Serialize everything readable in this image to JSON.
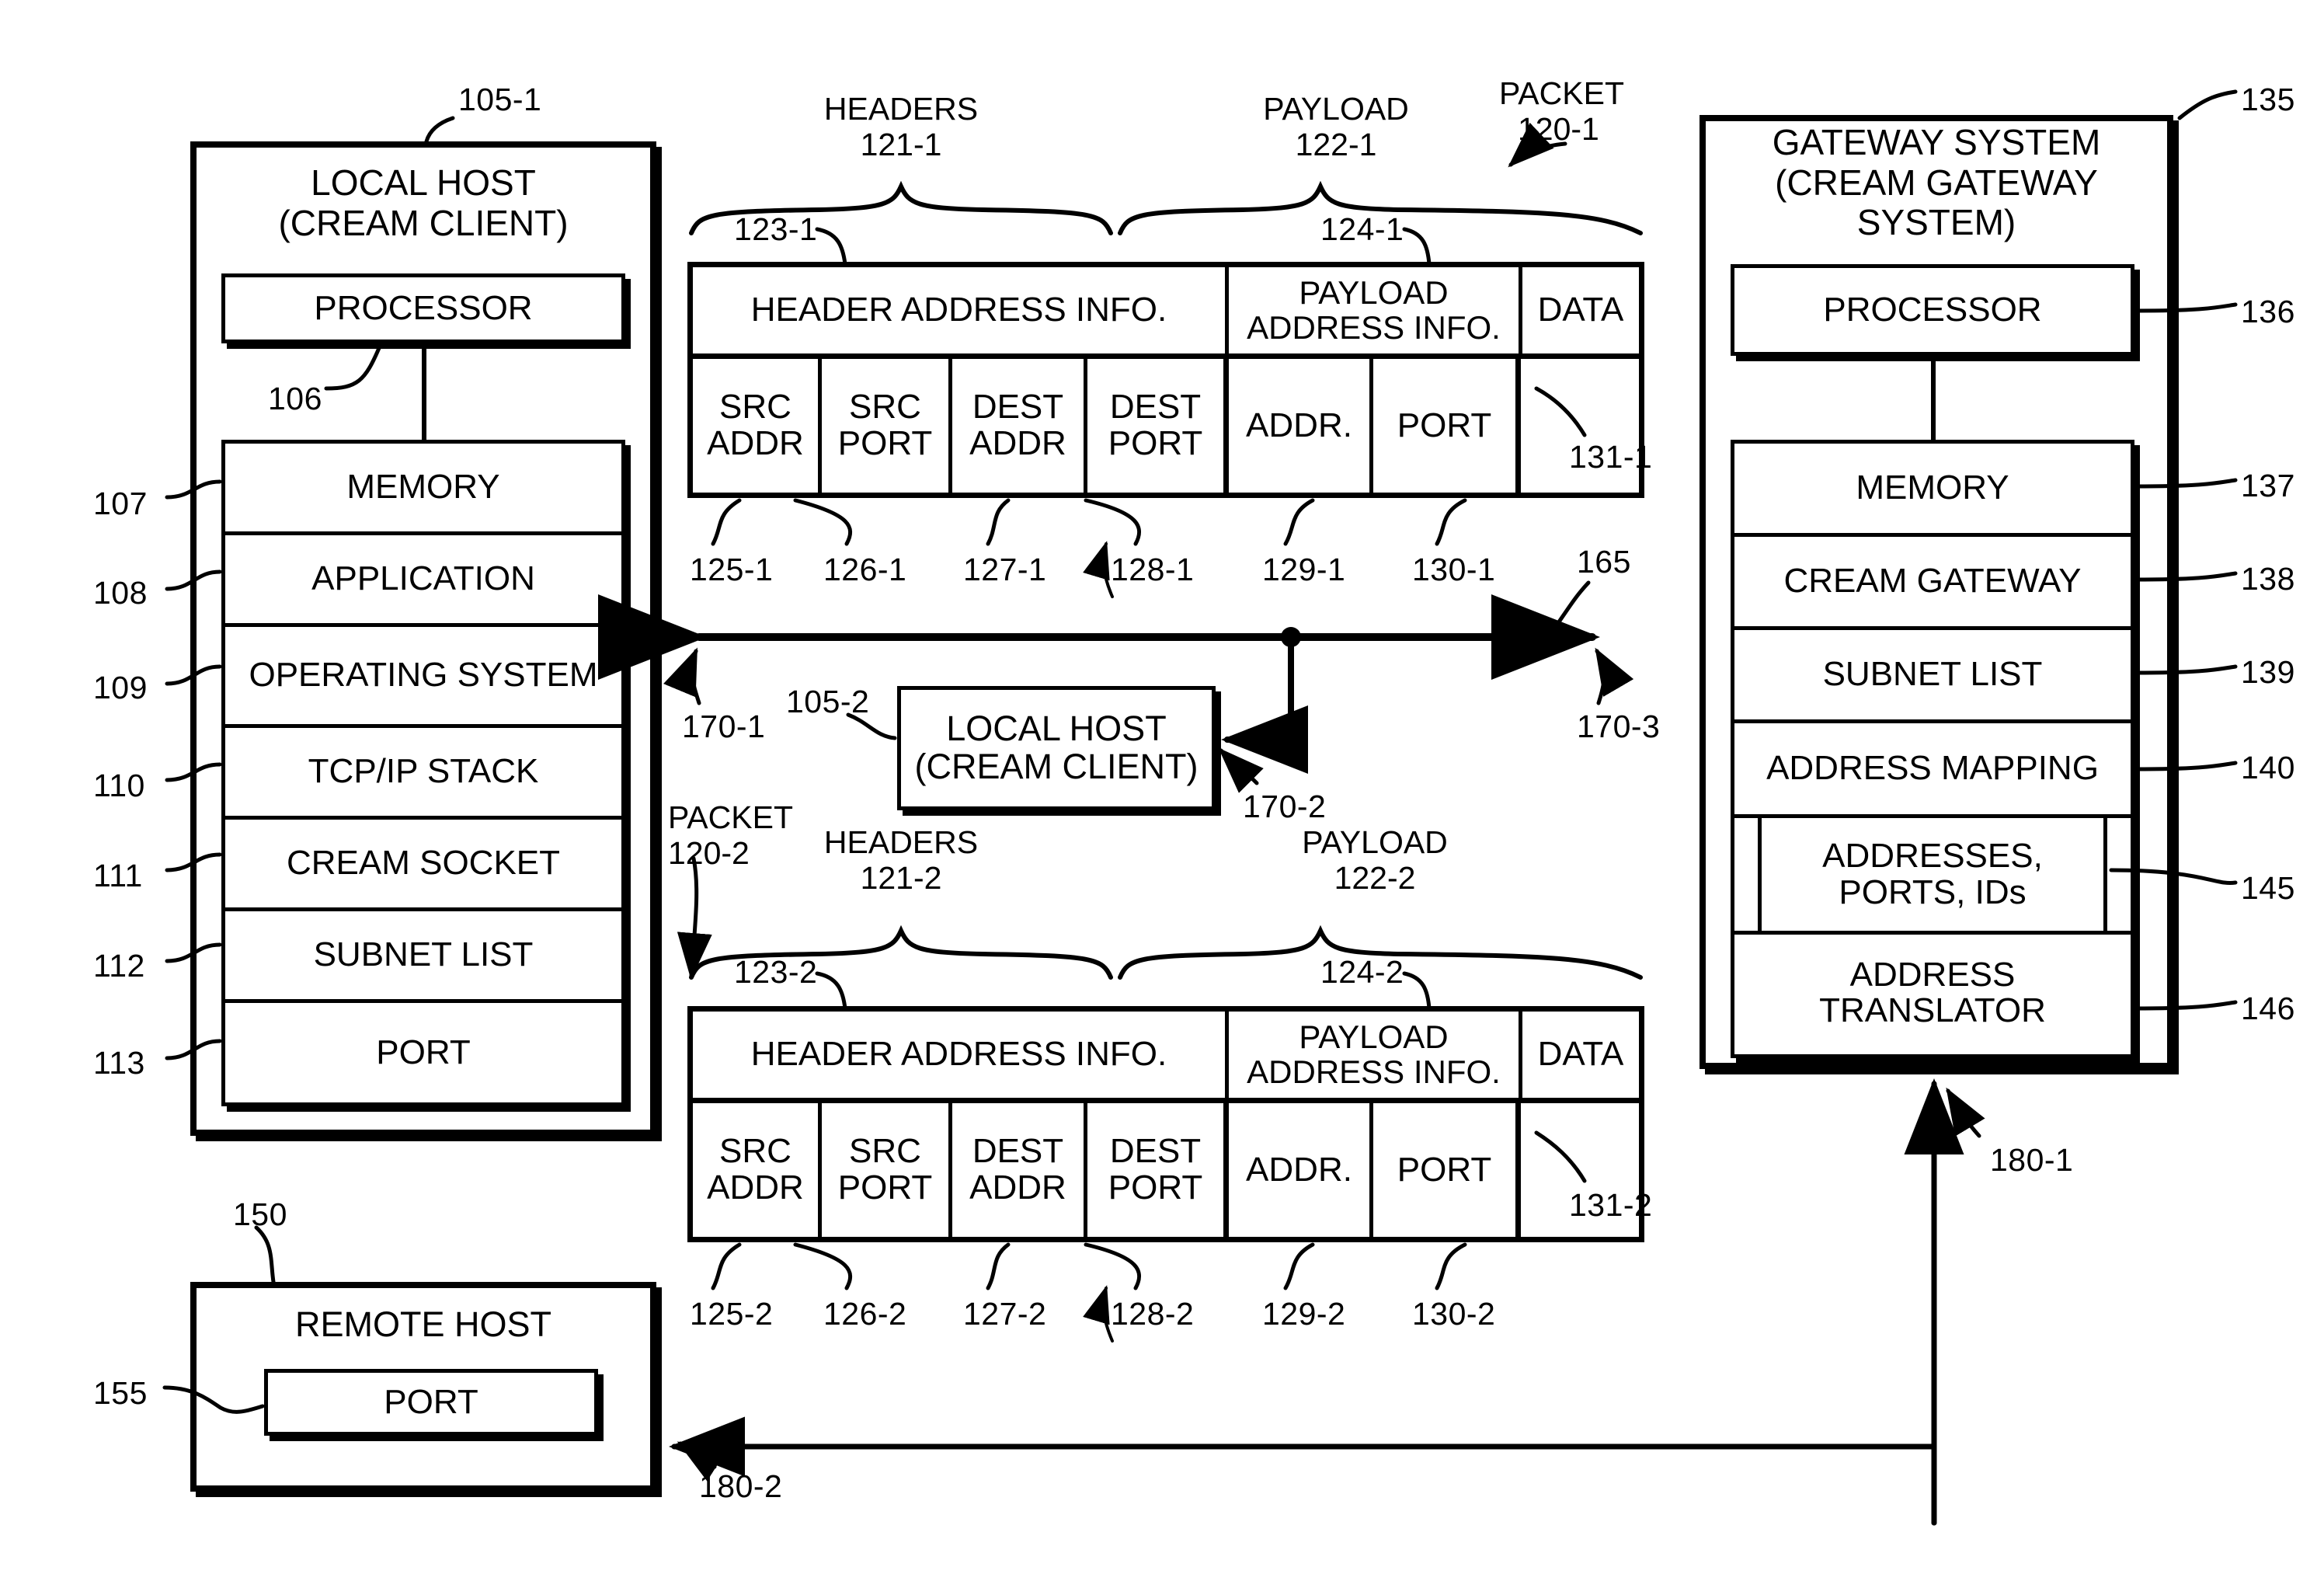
{
  "figure": {
    "type": "patent-block-diagram"
  },
  "local_host": {
    "title_line1": "LOCAL HOST",
    "title_line2": "(CREAM CLIENT)",
    "ref": "105-1",
    "processor": {
      "label": "PROCESSOR",
      "ref": "106"
    },
    "memory_rows": [
      {
        "label": "MEMORY",
        "ref": "107"
      },
      {
        "label": "APPLICATION",
        "ref": "108"
      },
      {
        "label": "OPERATING SYSTEM",
        "ref": "109"
      },
      {
        "label": "TCP/IP STACK",
        "ref": "110"
      },
      {
        "label": "CREAM SOCKET",
        "ref": "111"
      },
      {
        "label": "SUBNET LIST",
        "ref": "112"
      },
      {
        "label": "PORT",
        "ref": "113"
      }
    ]
  },
  "gateway": {
    "title_line1": "GATEWAY SYSTEM",
    "title_line2": "(CREAM GATEWAY",
    "title_line3": "SYSTEM)",
    "ref": "135",
    "processor": {
      "label": "PROCESSOR",
      "ref": "136"
    },
    "memory_rows": [
      {
        "label": "MEMORY",
        "ref": "137"
      },
      {
        "label": "CREAM GATEWAY",
        "ref": "138"
      },
      {
        "label": "SUBNET LIST",
        "ref": "139"
      },
      {
        "label": "ADDRESS MAPPING",
        "ref": "140"
      },
      {
        "label": "ADDRESSES, PORTS, IDs",
        "ref": "145"
      },
      {
        "label": "ADDRESS TRANSLATOR",
        "ref": "146"
      }
    ],
    "inbound_arrow_ref": "180-1"
  },
  "remote_host": {
    "title": "REMOTE HOST",
    "ref": "150",
    "port": {
      "label": "PORT",
      "ref": "155"
    },
    "inbound_arrow_ref": "180-2"
  },
  "middle_host": {
    "title_line1": "LOCAL HOST",
    "title_line2": "(CREAM CLIENT)",
    "ref": "105-2"
  },
  "network_line": {
    "ref": "165",
    "left_arrow_ref": "170-1",
    "branch_ref": "170-2",
    "right_arrow_ref": "170-3"
  },
  "packet_1": {
    "packet_caption": "PACKET",
    "packet_ref": "120-1",
    "headers_caption": "HEADERS",
    "headers_ref": "121-1",
    "payload_caption": "PAYLOAD",
    "payload_ref": "122-1",
    "header_block": {
      "label": "HEADER ADDRESS INFO.",
      "ref": "123-1"
    },
    "payload_block": {
      "label": "PAYLOAD ADDRESS INFO.",
      "ref": "124-1"
    },
    "data_block": {
      "label": "DATA",
      "ref": "131-1"
    },
    "fields": [
      {
        "line1": "SRC",
        "line2": "ADDR",
        "ref": "125-1"
      },
      {
        "line1": "SRC",
        "line2": "PORT",
        "ref": "126-1"
      },
      {
        "line1": "DEST",
        "line2": "ADDR",
        "ref": "127-1"
      },
      {
        "line1": "DEST",
        "line2": "PORT",
        "ref": "128-1"
      },
      {
        "line1": "ADDR.",
        "line2": "",
        "ref": "129-1"
      },
      {
        "line1": "PORT",
        "line2": "",
        "ref": "130-1"
      }
    ]
  },
  "packet_2": {
    "packet_caption": "PACKET",
    "packet_ref": "120-2",
    "headers_caption": "HEADERS",
    "headers_ref": "121-2",
    "payload_caption": "PAYLOAD",
    "payload_ref": "122-2",
    "header_block": {
      "label": "HEADER ADDRESS INFO.",
      "ref": "123-2"
    },
    "payload_block": {
      "label": "PAYLOAD ADDRESS INFO.",
      "ref": "124-2"
    },
    "data_block": {
      "label": "DATA",
      "ref": "131-2"
    },
    "fields": [
      {
        "line1": "SRC",
        "line2": "ADDR",
        "ref": "125-2"
      },
      {
        "line1": "SRC",
        "line2": "PORT",
        "ref": "126-2"
      },
      {
        "line1": "DEST",
        "line2": "ADDR",
        "ref": "127-2"
      },
      {
        "line1": "DEST",
        "line2": "PORT",
        "ref": "128-2"
      },
      {
        "line1": "ADDR.",
        "line2": "",
        "ref": "129-2"
      },
      {
        "line1": "PORT",
        "line2": "",
        "ref": "130-2"
      }
    ]
  }
}
